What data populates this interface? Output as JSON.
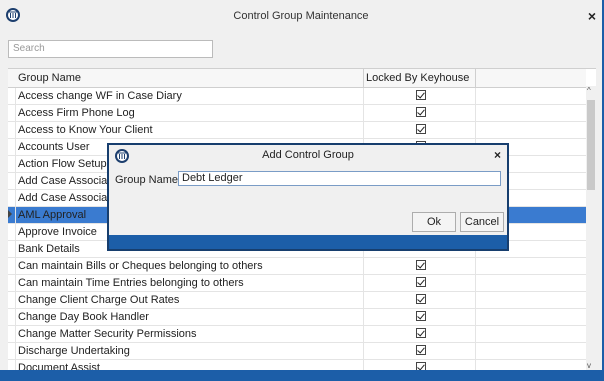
{
  "window": {
    "title": "Control Group Maintenance",
    "close": "×"
  },
  "search": {
    "placeholder": "Search"
  },
  "grid": {
    "columns": [
      "Group Name",
      "Locked By Keyhouse"
    ],
    "rows": [
      {
        "name": "Access change WF in Case Diary",
        "locked": true
      },
      {
        "name": "Access Firm Phone Log",
        "locked": true
      },
      {
        "name": "Access to Know Your Client",
        "locked": true
      },
      {
        "name": "Accounts User",
        "locked": true
      },
      {
        "name": "Action Flow Setup",
        "locked": false
      },
      {
        "name": "Add Case Associate",
        "locked": false
      },
      {
        "name": "Add Case Associate",
        "locked": false
      },
      {
        "name": "AML Approval",
        "locked": false,
        "selected": true
      },
      {
        "name": "Approve Invoice",
        "locked": false
      },
      {
        "name": "Bank Details",
        "locked": false
      },
      {
        "name": "Can maintain Bills or Cheques belonging to others",
        "locked": true
      },
      {
        "name": "Can maintain Time Entries belonging to others",
        "locked": true
      },
      {
        "name": "Change Client Charge Out Rates",
        "locked": true
      },
      {
        "name": "Change Day Book Handler",
        "locked": true
      },
      {
        "name": "Change Matter Security Permissions",
        "locked": true
      },
      {
        "name": "Discharge Undertaking",
        "locked": true
      },
      {
        "name": "Document Assist",
        "locked": true
      }
    ]
  },
  "dialog": {
    "title": "Add Control Group",
    "close": "×",
    "label": "Group Name:",
    "value": "Debt Ledger",
    "ok": "Ok",
    "cancel": "Cancel"
  },
  "colors": {
    "accent": "#1c5ea8",
    "selection": "#3a7bd0"
  }
}
